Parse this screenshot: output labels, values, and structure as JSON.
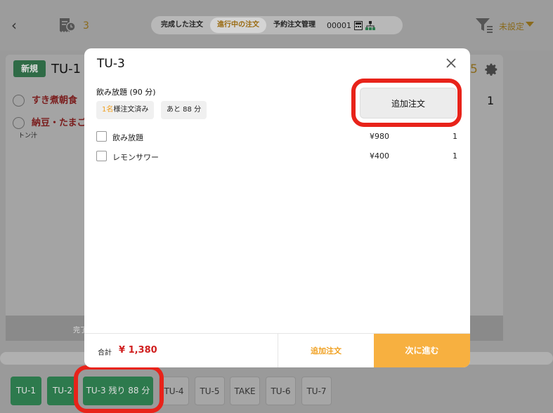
{
  "topbar": {
    "receipt_count": "3",
    "segments": [
      "完成した注文",
      "進行中の注文",
      "予約注文管理"
    ],
    "active_segment": "進行中の注文",
    "code": "00001",
    "filter_label": "未設定"
  },
  "background_order": {
    "badge": "新規",
    "title": "TU-1",
    "items": [
      "すき煮朝食",
      "納豆・たまご"
    ],
    "sub_note": "トン汁",
    "right_number": "5",
    "right_qty": "1",
    "band_text": "完了"
  },
  "modal": {
    "title": "TU-3",
    "section_title": "飲み放題 (90 分)",
    "chip_ordered_highlight": "1名",
    "chip_ordered_rest": "様注文済み",
    "chip_remaining": "あと 88 分",
    "add_order_button": "追加注文",
    "items": [
      {
        "name": "飲み放題",
        "price": "¥980",
        "qty": "1"
      },
      {
        "name": "レモンサワー",
        "price": "¥400",
        "qty": "1"
      }
    ],
    "total_label": "合計",
    "total_value": "¥ 1,380",
    "footer_add": "追加注文",
    "footer_next": "次に進む"
  },
  "tabs": [
    {
      "label": "TU-1",
      "style": "green"
    },
    {
      "label": "TU-2",
      "style": "green"
    },
    {
      "label": "TU-3 残り 88 分",
      "style": "green"
    },
    {
      "label": "TU-4",
      "style": "gray"
    },
    {
      "label": "TU-5",
      "style": "gray"
    },
    {
      "label": "TAKE",
      "style": "gray"
    },
    {
      "label": "TU-6",
      "style": "gray"
    },
    {
      "label": "TU-7",
      "style": "gray"
    }
  ],
  "colors": {
    "accent_orange": "#f7b040",
    "highlight_red": "#e8231a",
    "table_green": "#2d7a4d",
    "total_red": "#d02020"
  }
}
